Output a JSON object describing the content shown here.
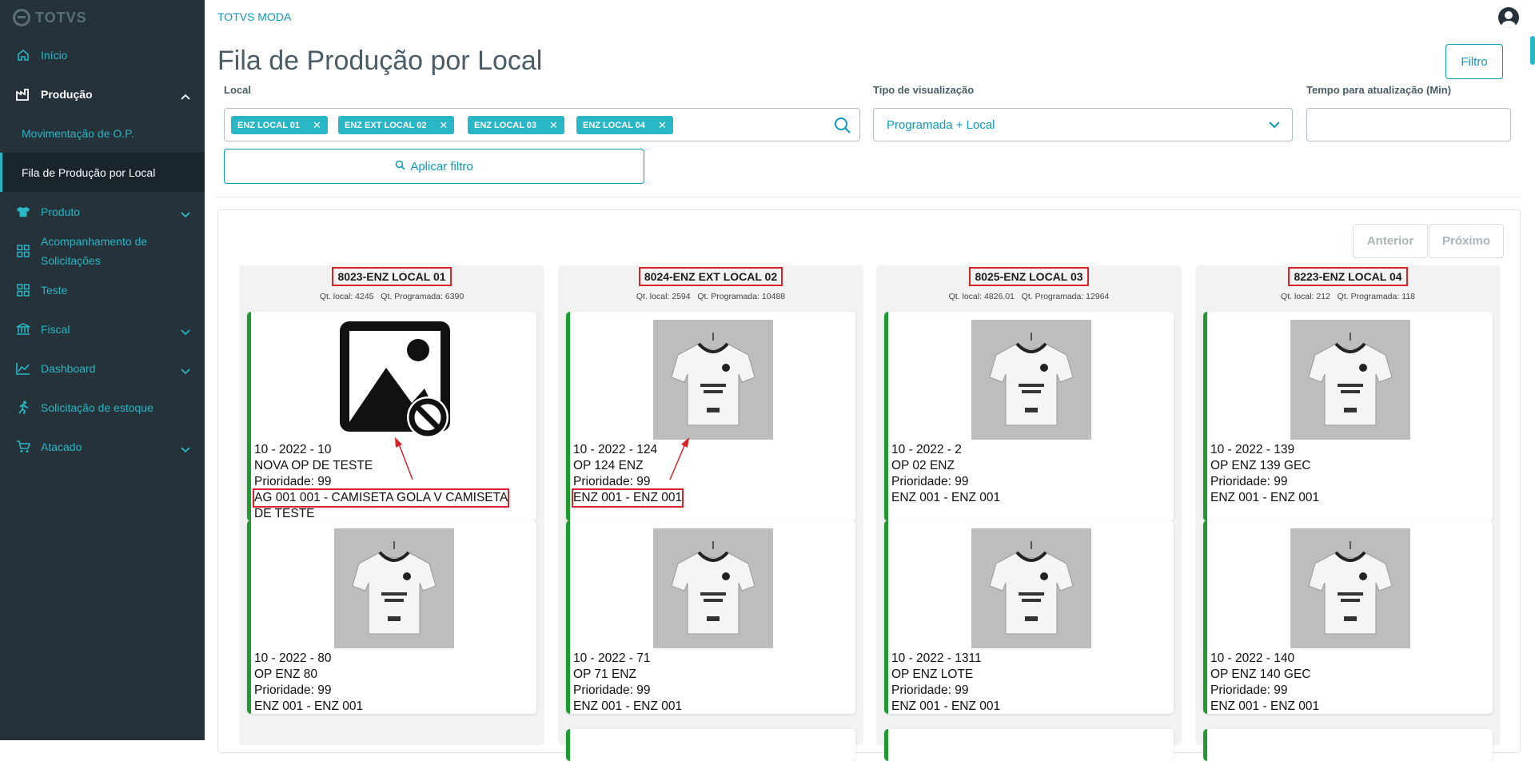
{
  "app": {
    "logo": "TOTVS",
    "brand": "TOTVS MODA"
  },
  "sidebar": {
    "items": [
      {
        "label": "Início",
        "icon": "home-icon"
      },
      {
        "label": "Produção",
        "icon": "factory-icon",
        "open": true
      },
      {
        "label": "Produto",
        "icon": "shirt-icon"
      },
      {
        "label": "Acompanhamento de Solicitações",
        "icon": "grid-icon"
      },
      {
        "label": "Teste",
        "icon": "grid-icon"
      },
      {
        "label": "Fiscal",
        "icon": "bank-icon"
      },
      {
        "label": "Dashboard",
        "icon": "chart-icon"
      },
      {
        "label": "Solicitação de estoque",
        "icon": "running-icon"
      },
      {
        "label": "Atacado",
        "icon": "cart-icon"
      }
    ],
    "submenu": [
      {
        "label": "Movimentação de O.P."
      },
      {
        "label": "Fila de Produção por Local",
        "active": true
      }
    ],
    "acomp_line1": "Acompanhamento de",
    "acomp_line2": "Solicitações"
  },
  "page": {
    "title": "Fila de Produção por Local",
    "filter_button": "Filtro"
  },
  "filters": {
    "local_label": "Local",
    "local_tags": [
      "ENZ LOCAL 01",
      "ENZ EXT LOCAL 02",
      "ENZ LOCAL 03",
      "ENZ LOCAL 04"
    ],
    "view_label": "Tipo de visualização",
    "view_value": "Programada + Local",
    "refresh_label": "Tempo para atualização (Min)",
    "refresh_value": "",
    "apply_button": "Aplicar filtro"
  },
  "pager": {
    "prev": "Anterior",
    "next": "Próximo"
  },
  "columns": [
    {
      "title": "8023-ENZ LOCAL 01",
      "stats": "Qt. local: 4245   Qt. Programada: 6390",
      "cards": [
        {
          "image": "no-image-icon",
          "l1": "10 - 2022 - 10",
          "l2": "NOVA OP DE TESTE",
          "l3": "Prioridade: 99",
          "l4": "AG 001 001 - CAMISETA GOLA V CAMISETA",
          "l5": "DE TESTE"
        },
        {
          "image": "shirt-photo",
          "l1": "10 - 2022 - 80",
          "l2": "OP ENZ 80",
          "l3": "Prioridade: 99",
          "l4": "ENZ 001 - ENZ 001"
        }
      ]
    },
    {
      "title": "8024-ENZ EXT LOCAL 02",
      "stats": "Qt. local: 2594   Qt. Programada: 10488",
      "cards": [
        {
          "image": "shirt-photo",
          "l1": "10 - 2022 - 124",
          "l2": "OP 124 ENZ",
          "l3": "Prioridade: 99",
          "l4": "ENZ 001 - ENZ 001"
        },
        {
          "image": "shirt-photo",
          "l1": "10 - 2022 - 71",
          "l2": "OP 71 ENZ",
          "l3": "Prioridade: 99",
          "l4": "ENZ 001 - ENZ 001"
        }
      ]
    },
    {
      "title": "8025-ENZ LOCAL 03",
      "stats": "Qt. local: 4826.01   Qt. Programada: 12964",
      "cards": [
        {
          "image": "shirt-photo",
          "l1": "10 - 2022 - 2",
          "l2": "OP 02 ENZ",
          "l3": "Prioridade: 99",
          "l4": "ENZ 001 - ENZ 001"
        },
        {
          "image": "shirt-photo",
          "l1": "10 - 2022 - 1311",
          "l2": "OP ENZ LOTE",
          "l3": "Prioridade: 99",
          "l4": "ENZ 001 - ENZ 001"
        }
      ]
    },
    {
      "title": "8223-ENZ LOCAL 04",
      "stats": "Qt. local: 212   Qt. Programada: 118",
      "cards": [
        {
          "image": "shirt-photo",
          "l1": "10 - 2022 - 139",
          "l2": "OP ENZ 139 GEC",
          "l3": "Prioridade: 99",
          "l4": "ENZ 001 - ENZ 001"
        },
        {
          "image": "shirt-photo",
          "l1": "10 - 2022 - 140",
          "l2": "OP ENZ 140 GEC",
          "l3": "Prioridade: 99",
          "l4": "ENZ 001 - ENZ 001"
        }
      ]
    }
  ],
  "colors": {
    "sidebar_bg": "#253239",
    "accent": "#29b6c5",
    "primary": "#0c9abe",
    "status_bar": "#1e9b2f",
    "highlight": "#d9232a"
  }
}
